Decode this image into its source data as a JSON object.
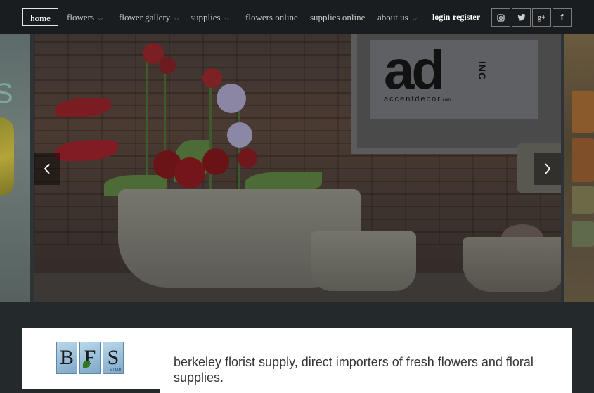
{
  "nav": {
    "items": [
      {
        "label": "home",
        "has_dropdown": false,
        "active": true
      },
      {
        "label": "flowers",
        "has_dropdown": true
      },
      {
        "label": "flower gallery",
        "has_dropdown": true
      },
      {
        "label": "supplies",
        "has_dropdown": true
      },
      {
        "label": "flowers online",
        "has_dropdown": false
      },
      {
        "label": "supplies online",
        "has_dropdown": false
      },
      {
        "label": "about us",
        "has_dropdown": true
      }
    ],
    "login": "login",
    "register": "register",
    "social": [
      "instagram-icon",
      "twitter-icon",
      "google-plus-icon",
      "facebook-icon"
    ]
  },
  "slider": {
    "logo_main": "ad",
    "logo_inc": "INC",
    "logo_sub": "accentdecor",
    "logo_com": ".com",
    "left_side_glyph": "S",
    "prev_icon": "chevron-left-icon",
    "next_icon": "chevron-right-icon"
  },
  "brand": {
    "letters": [
      "B",
      "F",
      "S"
    ],
    "miami": "MIAMI"
  },
  "intro": {
    "tagline": "berkeley florist supply, direct importers of fresh flowers and floral supplies."
  },
  "colors": {
    "nav_bg": "#1a1d1f",
    "band_bg": "#24292b",
    "text_light": "#c9c9c9",
    "text_dark": "#333333"
  }
}
